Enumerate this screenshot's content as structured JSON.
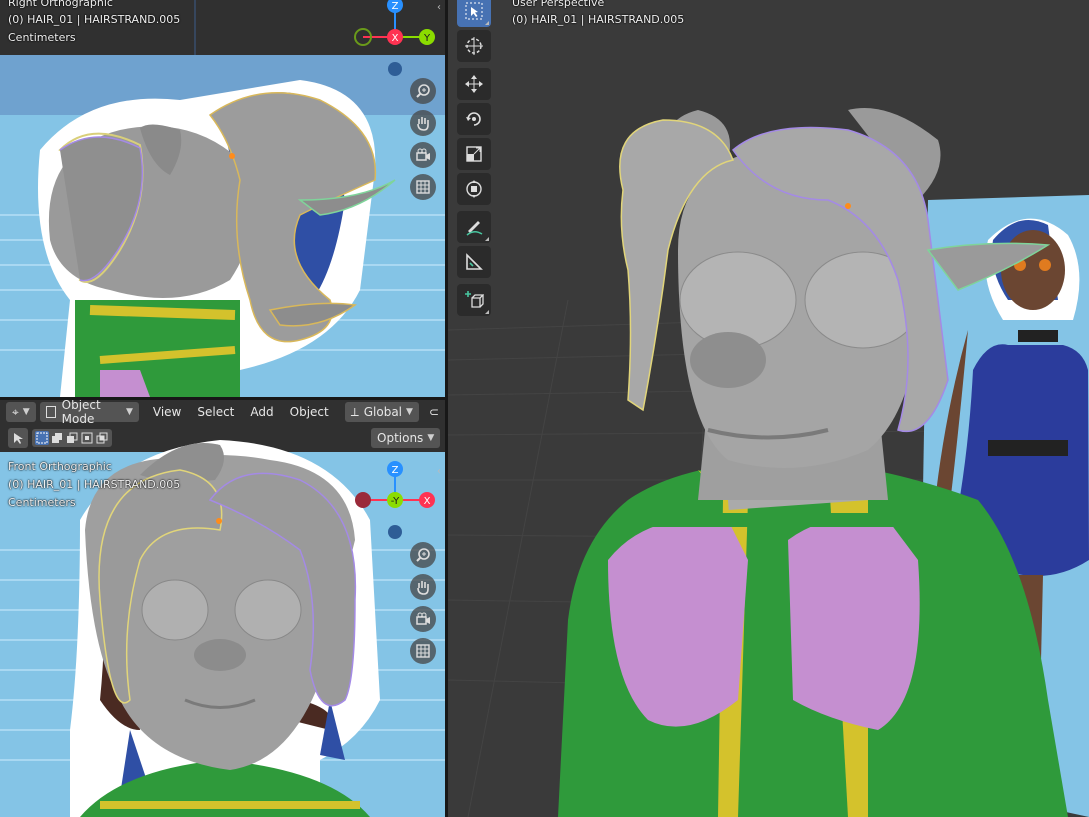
{
  "top_left_viewport": {
    "view_name": "Right Orthographic",
    "object_info": "(0) HAIR_01 | HAIRSTRAND.005",
    "units": "Centimeters",
    "gizmo": {
      "top": "Z",
      "center": "X",
      "right": "Y"
    }
  },
  "bottom_left_viewport": {
    "view_name": "Front Orthographic",
    "object_info": "(0) HAIR_01 | HAIRSTRAND.005",
    "units": "Centimeters",
    "gizmo": {
      "top": "Z",
      "center": "-Y",
      "right": "X"
    }
  },
  "right_viewport": {
    "view_name": "User Perspective",
    "object_info": "(0) HAIR_01 | HAIRSTRAND.005"
  },
  "header": {
    "mode_label": "Object Mode",
    "menus": [
      "View",
      "Select",
      "Add",
      "Object"
    ],
    "orientation_label": "Global",
    "options_label": "Options"
  },
  "icons": [
    "zoom-icon",
    "hand-pan-icon",
    "camera-icon",
    "grid-icon",
    "select-box-icon",
    "cursor-icon",
    "move-icon",
    "rotate-icon",
    "scale-icon",
    "transform-icon",
    "annotate-icon",
    "measure-icon",
    "add-cube-icon"
  ],
  "colors": {
    "x_axis": "#ff3352",
    "y_axis": "#8bdc00",
    "z_axis": "#2890ff",
    "accent": "#4772b3",
    "bg_sky": "#7fc1e8"
  }
}
